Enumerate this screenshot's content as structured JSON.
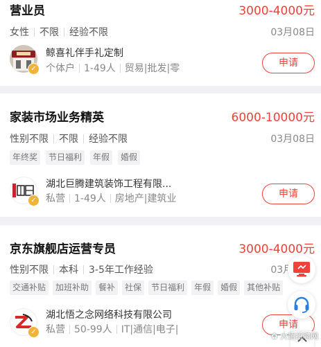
{
  "jobs": [
    {
      "title": "营业员",
      "salary": "3000-4000元",
      "requirements": [
        "女性",
        "不限",
        "经验不限"
      ],
      "date": "03月08日",
      "tags": [],
      "company": "鲸喜礼伴手礼定制",
      "company_info": [
        "个体户",
        "1-49人",
        "贸易|批发|零"
      ],
      "apply_label": "申请"
    },
    {
      "title": "家装市场业务精英",
      "salary": "6000-10000元",
      "requirements": [
        "性别不限",
        "不限",
        "经验不限"
      ],
      "date": "03月08日",
      "tags": [
        "年终奖",
        "节日福利",
        "年假",
        "婚假"
      ],
      "company": "湖北巨腾建筑装饰工程有限...",
      "company_info": [
        "私营",
        "1-49人",
        "房地产|建筑业"
      ],
      "apply_label": "申请"
    },
    {
      "title": "京东旗舰店运营专员",
      "salary": "3000-4000元",
      "requirements": [
        "性别不限",
        "本科",
        "3-5年工作经验"
      ],
      "date": "03月08日",
      "tags": [
        "交通补贴",
        "加班补助",
        "餐补",
        "社保",
        "节日福利",
        "年假",
        "婚假",
        "其他补贴"
      ],
      "company": "湖北悟之念网络科技有限公司",
      "company_info": [
        "私营",
        "50-99人",
        "IT|通信|电子|"
      ],
      "apply_label": "申请"
    }
  ],
  "logo_text": {
    "job2": "巨腾"
  },
  "watermark": "大悟招聘网",
  "colors": {
    "salary": "#f0413a",
    "accent": "#f0413a",
    "tag_bg": "#f2f2f4",
    "page_bg": "#f1f1f5"
  },
  "icons": {
    "verified_badge": "check-badge-icon",
    "float_top": "monitor-icon",
    "float_bottom": "headset-icon",
    "scroll_up": "chevron-up-icon"
  }
}
